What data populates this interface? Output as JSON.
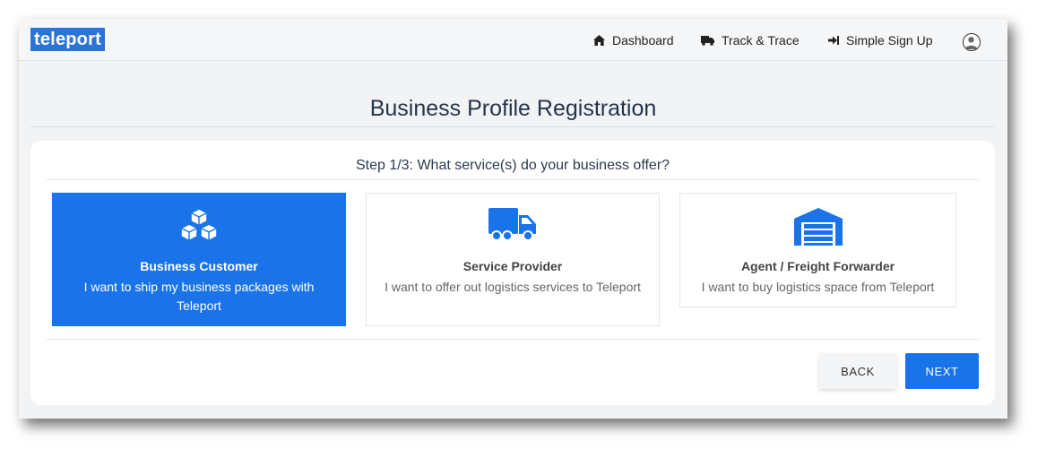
{
  "app": {
    "logo_text": "teleport"
  },
  "nav": {
    "links": [
      {
        "label": "Dashboard",
        "icon": "home-icon"
      },
      {
        "label": "Track & Trace",
        "icon": "truck-icon"
      },
      {
        "label": "Simple Sign Up",
        "icon": "sign-in-icon"
      }
    ],
    "avatar_icon": "user-avatar-icon"
  },
  "page": {
    "title": "Business Profile Registration"
  },
  "step": {
    "title": "Step 1/3: What service(s) do your business offer?",
    "options": [
      {
        "title": "Business Customer",
        "description": "I want to ship my business packages with Teleport",
        "icon": "boxes-icon",
        "selected": true
      },
      {
        "title": "Service Provider",
        "description": "I want to offer out logistics services to Teleport",
        "icon": "truck-icon",
        "selected": false
      },
      {
        "title": "Agent / Freight Forwarder",
        "description": "I want to buy logistics space from Teleport",
        "icon": "warehouse-icon",
        "selected": false
      }
    ]
  },
  "buttons": {
    "back_label": "BACK",
    "next_label": "NEXT"
  },
  "colors": {
    "primary": "#1a73e8",
    "logo_bg": "#2b73d9",
    "background": "#f2f3f5"
  }
}
